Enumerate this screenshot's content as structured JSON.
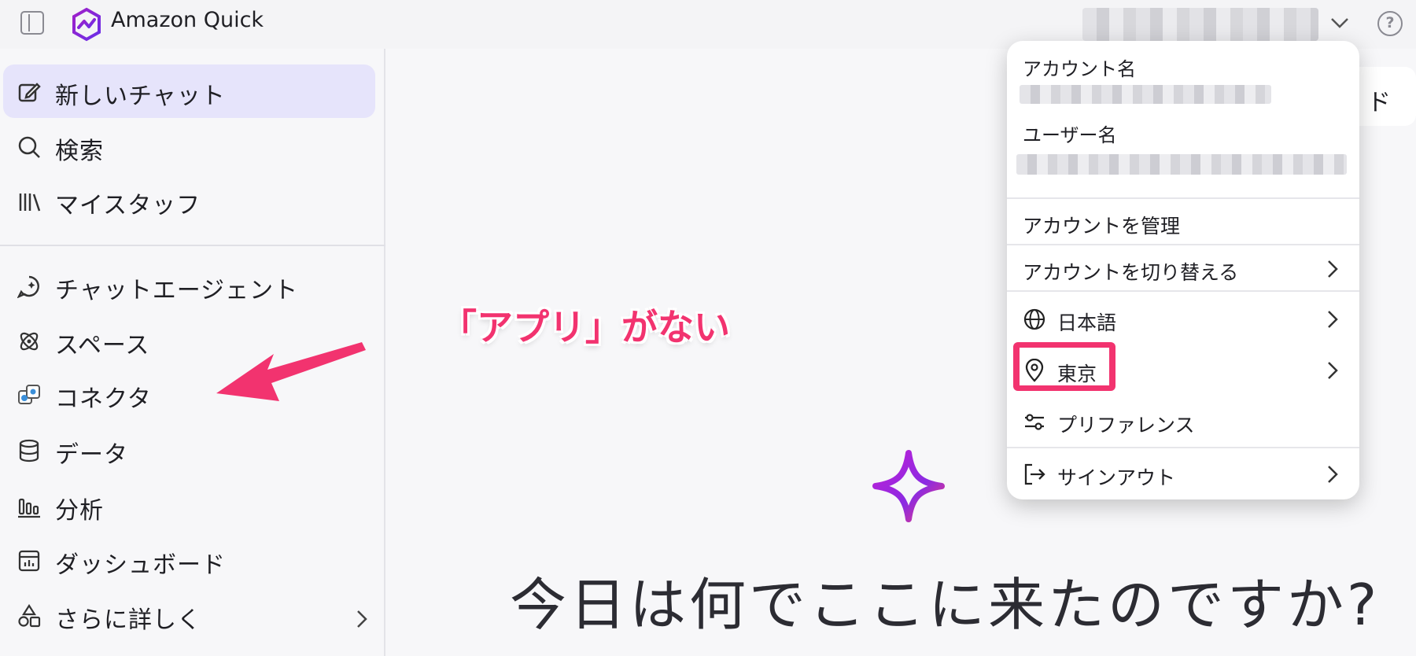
{
  "app": {
    "title": "Amazon Quick"
  },
  "sidebar": {
    "items": [
      {
        "label": "新しいチャット",
        "icon": "edit-icon"
      },
      {
        "label": "検索",
        "icon": "search-icon"
      },
      {
        "label": "マイスタッフ",
        "icon": "library-icon"
      },
      {
        "label": "チャットエージェント",
        "icon": "chat-agent-icon"
      },
      {
        "label": "スペース",
        "icon": "spaces-icon"
      },
      {
        "label": "コネクタ",
        "icon": "connector-icon"
      },
      {
        "label": "データ",
        "icon": "database-icon"
      },
      {
        "label": "分析",
        "icon": "chart-icon"
      },
      {
        "label": "ダッシュボード",
        "icon": "dashboard-icon"
      },
      {
        "label": "さらに詳しく",
        "icon": "shapes-icon"
      }
    ]
  },
  "annotation": {
    "text": "「アプリ」がない",
    "color": "#f2336f"
  },
  "main": {
    "partial_button": "ド",
    "greeting": "今日は何でここに来たのですか?"
  },
  "account_menu": {
    "account_label": "アカウント名",
    "user_label": "ユーザー名",
    "items": [
      {
        "label": "アカウントを管理"
      },
      {
        "label": "アカウントを切り替える"
      },
      {
        "label": "日本語",
        "icon": "globe-icon"
      },
      {
        "label": "東京",
        "icon": "location-pin-icon"
      },
      {
        "label": "プリファレンス",
        "icon": "sliders-icon"
      },
      {
        "label": "サインアウト",
        "icon": "sign-out-icon"
      }
    ]
  },
  "colors": {
    "accent": "#7a3cf0",
    "active_bg": "#e6e4fb",
    "highlight": "#f2336f"
  }
}
